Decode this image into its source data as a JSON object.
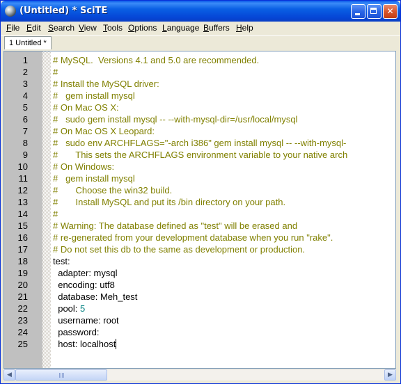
{
  "window": {
    "title": "(Untitled) * SciTE"
  },
  "menu": {
    "items": [
      "File",
      "Edit",
      "Search",
      "View",
      "Tools",
      "Options",
      "Language",
      "Buffers",
      "Help"
    ]
  },
  "tabs": [
    {
      "label": "1 Untitled *",
      "active": true
    }
  ],
  "editor": {
    "lines": [
      {
        "n": "1",
        "text": "# MySQL.  Versions 4.1 and 5.0 are recommended.",
        "kind": "comment"
      },
      {
        "n": "2",
        "text": "#",
        "kind": "comment"
      },
      {
        "n": "3",
        "text": "# Install the MySQL driver:",
        "kind": "comment"
      },
      {
        "n": "4",
        "text": "#   gem install mysql",
        "kind": "comment"
      },
      {
        "n": "5",
        "text": "# On Mac OS X:",
        "kind": "comment"
      },
      {
        "n": "6",
        "text": "#   sudo gem install mysql -- --with-mysql-dir=/usr/local/mysql",
        "kind": "comment"
      },
      {
        "n": "7",
        "text": "# On Mac OS X Leopard:",
        "kind": "comment"
      },
      {
        "n": "8",
        "text": "#   sudo env ARCHFLAGS=\"-arch i386\" gem install mysql -- --with-mysql-",
        "kind": "comment"
      },
      {
        "n": "9",
        "text": "#       This sets the ARCHFLAGS environment variable to your native arch",
        "kind": "comment"
      },
      {
        "n": "10",
        "text": "# On Windows:",
        "kind": "comment"
      },
      {
        "n": "11",
        "text": "#   gem install mysql",
        "kind": "comment"
      },
      {
        "n": "12",
        "text": "#       Choose the win32 build.",
        "kind": "comment"
      },
      {
        "n": "13",
        "text": "#       Install MySQL and put its /bin directory on your path.",
        "kind": "comment"
      },
      {
        "n": "14",
        "text": "#",
        "kind": "comment"
      },
      {
        "n": "15",
        "text": "# Warning: The database defined as \"test\" will be erased and",
        "kind": "comment"
      },
      {
        "n": "16",
        "text": "# re-generated from your development database when you run \"rake\".",
        "kind": "comment"
      },
      {
        "n": "17",
        "text": "# Do not set this db to the same as development or production.",
        "kind": "comment"
      },
      {
        "n": "18",
        "text": "test:",
        "kind": "code"
      },
      {
        "n": "19",
        "text": "  adapter: mysql",
        "kind": "code"
      },
      {
        "n": "20",
        "text": "  encoding: utf8",
        "kind": "code"
      },
      {
        "n": "21",
        "text": "  database: Meh_test",
        "kind": "code"
      },
      {
        "n": "22",
        "text": "  pool: ",
        "num": "5",
        "kind": "code"
      },
      {
        "n": "23",
        "text": "  username: root",
        "kind": "code"
      },
      {
        "n": "24",
        "text": "  password:",
        "kind": "code"
      },
      {
        "n": "25",
        "text": "  host: localhost",
        "kind": "code",
        "cursor": true
      }
    ]
  },
  "colors": {
    "comment": "#808000",
    "number": "#008080",
    "gutter": "#c0c0c0",
    "titlebar": "#0a5fe4"
  },
  "icons": {
    "app": "scite-sphere-icon",
    "minimize": "minimize-icon",
    "maximize": "maximize-icon",
    "close": "close-icon",
    "scroll_left": "arrow-left-icon",
    "scroll_right": "arrow-right-icon"
  }
}
